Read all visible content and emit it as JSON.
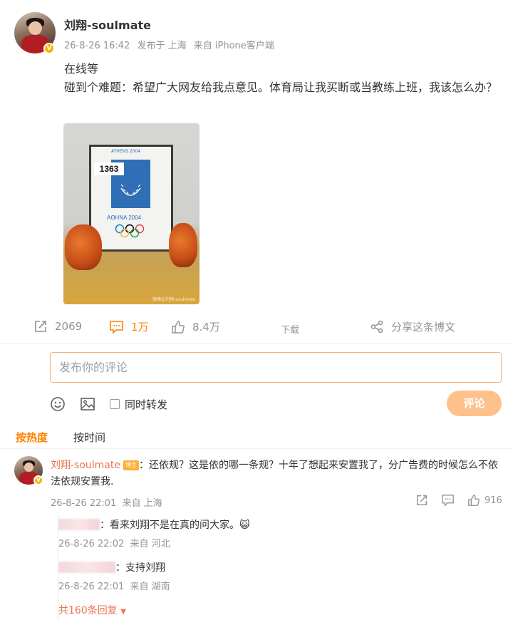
{
  "post": {
    "author": "刘翔-soulmate",
    "date": "26-8-26 16:42",
    "posted_in": "发布于 上海",
    "source": "来自 iPhone客户端",
    "line1": "在线等",
    "line2": "碰到个难题：希望广大网友给我点意见。体育局让我买断或当教练上班，我该怎么办？",
    "image": {
      "bib_number": "1363",
      "poster_top": "ATHENS 2004",
      "poster_bottom": "AΘHNA 2004",
      "watermark": "微博@刘翔-soulmate"
    }
  },
  "actions": {
    "reposts": "2069",
    "comments": "1万",
    "likes": "8.4万",
    "download": "下载",
    "share": "分享这条博文"
  },
  "composer": {
    "placeholder": "发布你的评论",
    "also_repost": "同时转发",
    "submit": "评论"
  },
  "sort": {
    "hot": "按热度",
    "time": "按时间"
  },
  "comment": {
    "author": "刘翔-soulmate",
    "badge": "博主",
    "text": "：还依规？这是依的哪一条规？十年了想起来安置我了，分广告费的时候怎么不依法依规安置我.",
    "date": "26-8-26 22:01",
    "location": "来自 上海",
    "likes": "916",
    "replies": [
      {
        "text": "：看来刘翔不是在真的问大家。😺",
        "date": "26-8-26 22:02",
        "location": "来自 河北"
      },
      {
        "text": "：支持刘翔",
        "date": "26-8-26 22:01",
        "location": "来自 湖南"
      }
    ],
    "more_replies": "共160条回复"
  },
  "colors": {
    "accent": "#ff8200",
    "name_link": "#eb7350",
    "meta_gray": "#939393",
    "submit_bg": "#ffc18c"
  }
}
